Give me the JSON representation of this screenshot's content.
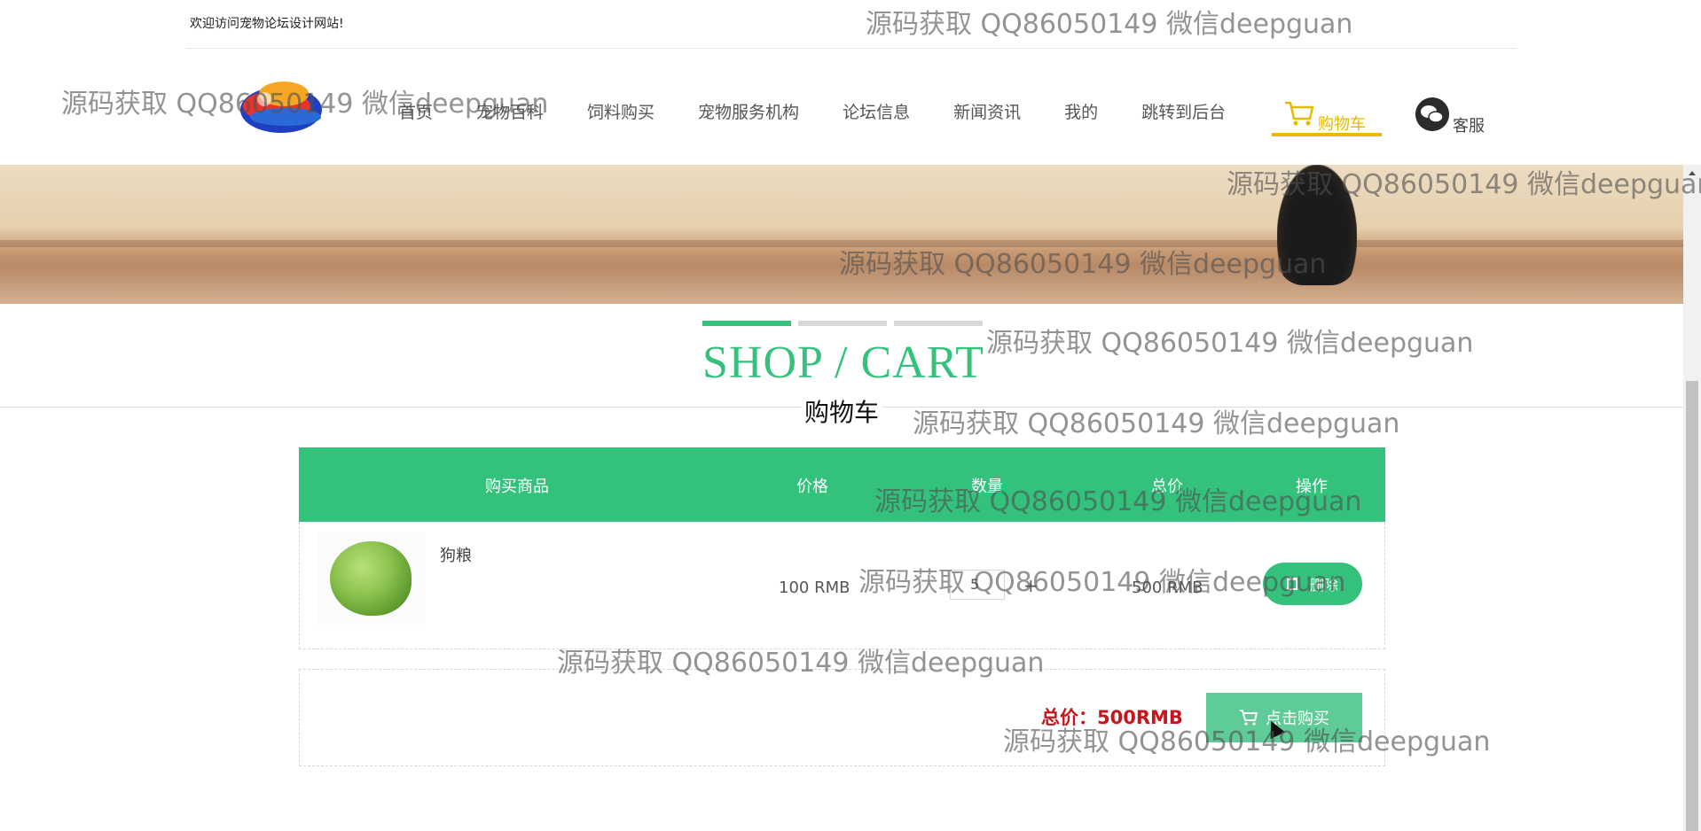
{
  "top": {
    "welcome": "欢迎访问宠物论坛设计网站!"
  },
  "nav": {
    "items": [
      "首页",
      "宠物百科",
      "饲料购买",
      "宠物服务机构",
      "论坛信息",
      "新闻资讯",
      "我的",
      "跳转到后台"
    ],
    "cart_label": "购物车",
    "service_label": "客服",
    "cart_color": "#e8b900"
  },
  "hero": {
    "title": "SHOP / CART",
    "subtitle": "购物车",
    "accent": "#33c17c"
  },
  "table": {
    "headers": [
      "购买商品",
      "价格",
      "数量",
      "总价",
      "操作"
    ],
    "rows": [
      {
        "name": "狗粮",
        "price": "100 RMB",
        "qty": "5",
        "qty_plus": "+",
        "total": "500 RMB",
        "delete": "删除"
      }
    ]
  },
  "summary": {
    "total_label": "总价：",
    "total_value": "500RMB",
    "buy_label": "点击购买"
  },
  "watermark": "源码获取 QQ86050149 微信deepguan"
}
